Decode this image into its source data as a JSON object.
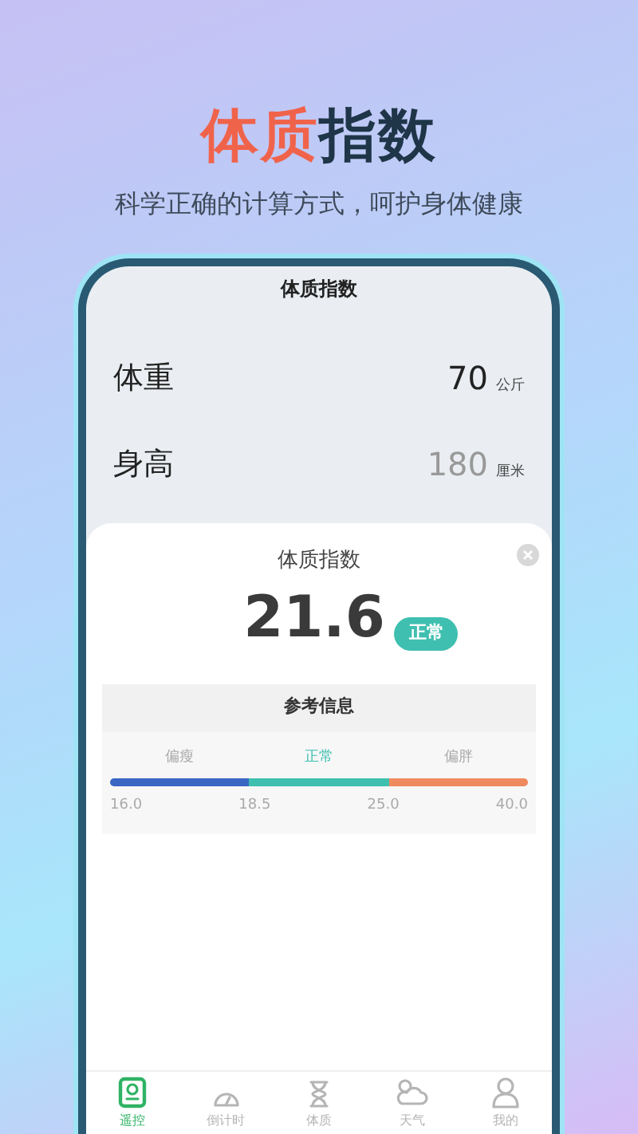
{
  "headline": {
    "highlight": "体质",
    "rest": "指数"
  },
  "subtitle": "科学正确的计算方式，呵护身体健康",
  "screen": {
    "title": "体质指数",
    "inputs": [
      {
        "label": "体重",
        "value": "70",
        "unit": "公斤",
        "filled": true
      },
      {
        "label": "身高",
        "value": "180",
        "unit": "厘米",
        "filled": false
      }
    ],
    "result": {
      "title": "体质指数",
      "bmi": "21.6",
      "badge": "正常",
      "reference": {
        "title": "参考信息",
        "segments": [
          {
            "label": "偏瘦",
            "color": "#3a66c4",
            "selected": false
          },
          {
            "label": "正常",
            "color": "#3fbfb0",
            "selected": true
          },
          {
            "label": "偏胖",
            "color": "#ef8a5f",
            "selected": false
          }
        ],
        "ticks": [
          "16.0",
          "18.5",
          "25.0",
          "40.0"
        ]
      }
    },
    "tabs": [
      {
        "label": "遥控",
        "kind": "remote",
        "selected": true
      },
      {
        "label": "倒计时",
        "kind": "gauge",
        "selected": false
      },
      {
        "label": "体质",
        "kind": "hourglass",
        "selected": false
      },
      {
        "label": "天气",
        "kind": "weather",
        "selected": false
      },
      {
        "label": "我的",
        "kind": "person",
        "selected": false
      }
    ]
  }
}
